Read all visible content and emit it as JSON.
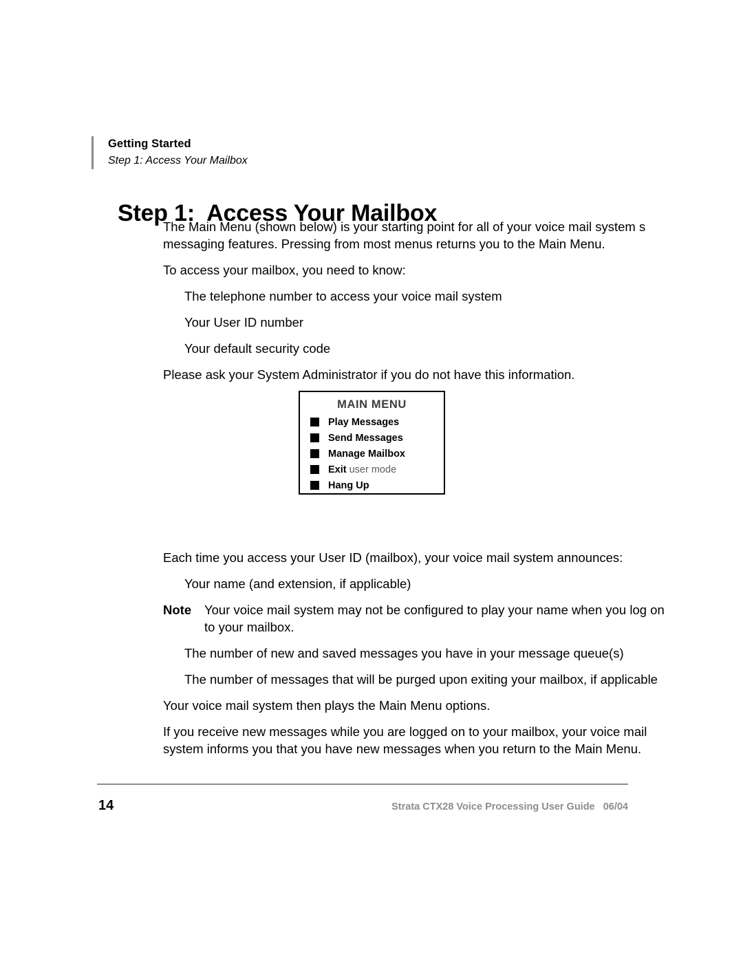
{
  "header": {
    "chapter": "Getting Started",
    "section": "Step 1:  Access Your Mailbox",
    "rule_color": "#8a8a8a"
  },
  "title": "Step 1:  Access Your Mailbox",
  "body": {
    "intro": "The Main Menu (shown below) is your starting point for all of your voice mail system s messaging features. Pressing from most menus returns you to the Main Menu.",
    "lead_in": "To access your mailbox, you need to know:",
    "requirements": [
      "The telephone number to access your voice mail system",
      "Your User ID number",
      "Your default security code"
    ],
    "ask_admin": "Please ask your System Administrator if you do not have this information.",
    "announces_lead": "Each time you access your User ID (mailbox), your voice mail system announces:",
    "announces_first": "Your name (and extension, if applicable)",
    "note_label": "Note",
    "note_text": "Your voice mail system may not be configured to play your name when you log on to your mailbox.",
    "announces_rest": [
      "The number of new and saved messages you have in your message queue(s)",
      "The number of messages that will be purged upon exiting your mailbox, if applicable"
    ],
    "then_plays": "Your voice mail system then plays the Main Menu options.",
    "new_messages": "If you receive new messages while you are logged on to your mailbox, your voice mail system informs you that you have new messages when you return to the Main Menu."
  },
  "figure": {
    "title": "MAIN MENU",
    "title_color": "#3d3d3d",
    "bullet_color": "#000000",
    "items": [
      {
        "label": "Play Messages",
        "dim": ""
      },
      {
        "label": "Send Messages",
        "dim": ""
      },
      {
        "label": "Manage Mailbox",
        "dim": ""
      },
      {
        "label": "Exit",
        "dim": " user mode"
      },
      {
        "label": "Hang Up",
        "dim": ""
      }
    ]
  },
  "footer": {
    "page_number": "14",
    "guide_text": "Strata CTX28 Voice Processing User Guide   06/04",
    "rule_color": "#8d8d8d",
    "text_color": "#8d8d8d"
  }
}
